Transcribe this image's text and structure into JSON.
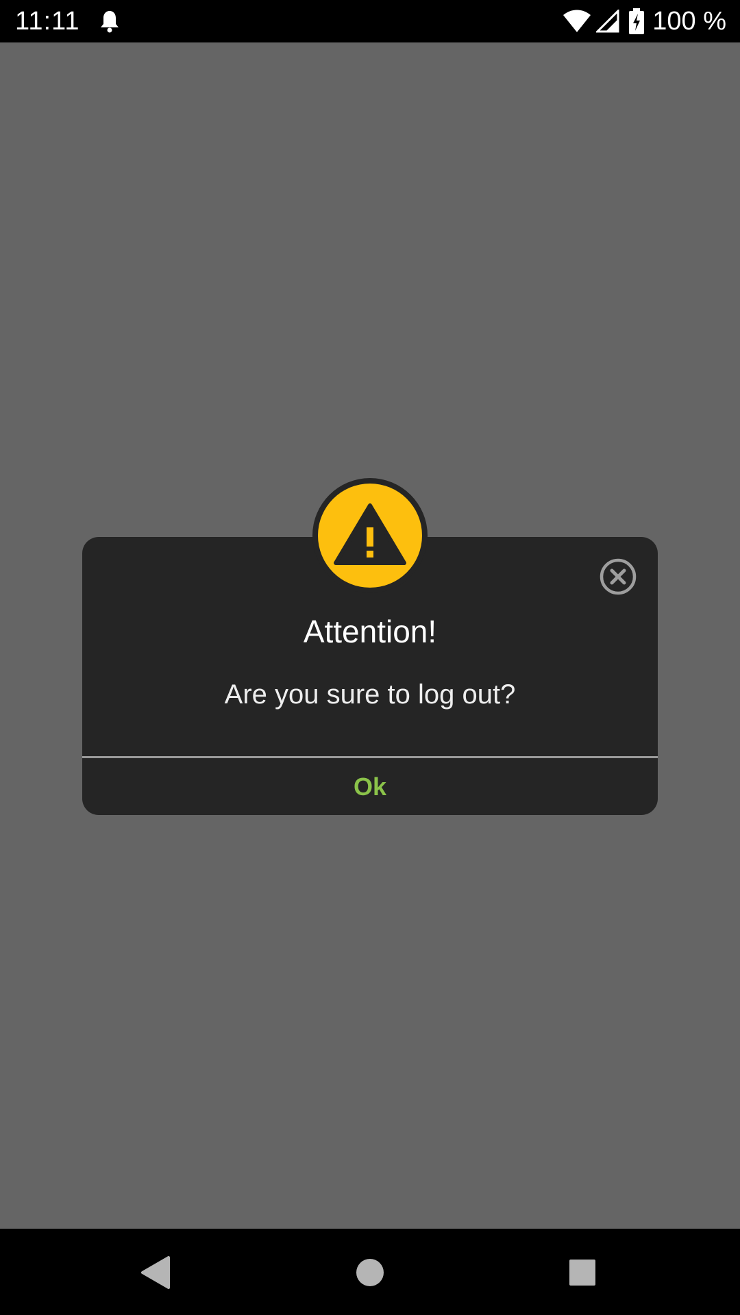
{
  "status_bar": {
    "time": "11:11",
    "battery_text": "100 %",
    "icons": [
      "notification-bell-icon",
      "wifi-icon",
      "cell-signal-icon",
      "battery-charging-icon"
    ]
  },
  "dialog": {
    "title": "Attention!",
    "message": "Are you sure to log out?",
    "ok_label": "Ok",
    "badge_icon": "warning-icon",
    "close_icon": "close-circle-icon"
  },
  "nav_bar": {
    "icons": [
      "back-icon",
      "home-icon",
      "recents-icon"
    ]
  },
  "colors": {
    "scrim": "#656565",
    "dialog_background": "#252525",
    "warning_yellow": "#fdbf0e",
    "ok_green": "#8bc34a",
    "divider": "#9b9b9b"
  }
}
